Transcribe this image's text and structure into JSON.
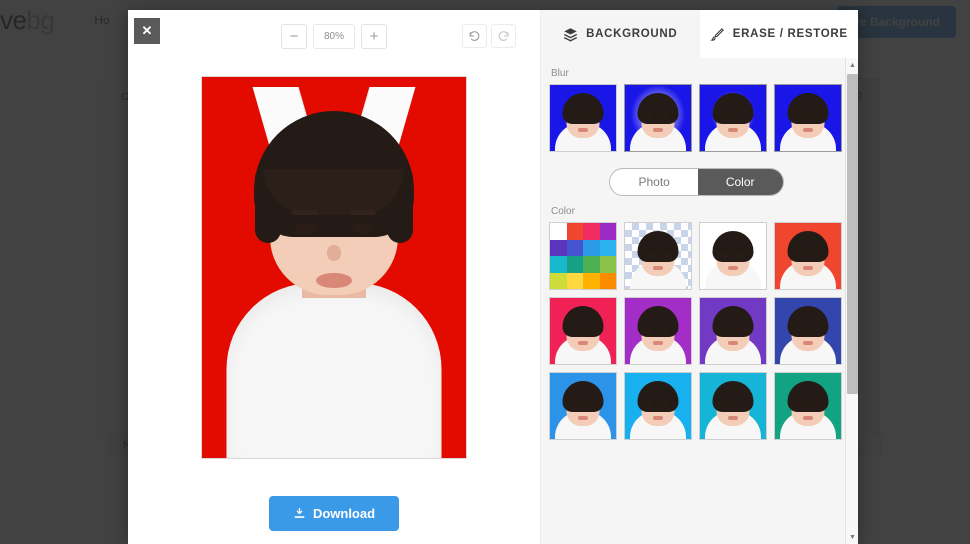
{
  "background_page": {
    "logo_main": "ove",
    "logo_accent": "bg",
    "nav": [
      {
        "label": "Ho"
      }
    ],
    "remove_background_button": "ve Background",
    "card_label": "C",
    "card_close_icon": "close-icon",
    "footer_text": "N"
  },
  "editor": {
    "toolbar": {
      "close_label": "✕",
      "zoom_out_label": "−",
      "zoom_value": "80%",
      "zoom_in_label": "+",
      "undo_icon": "undo-icon",
      "redo_icon": "redo-icon"
    },
    "canvas": {
      "background_color": "#E30B00",
      "subject": "portrait-photo"
    },
    "download_button": {
      "label": "Download",
      "icon": "download-icon",
      "color": "#3b9ae8"
    }
  },
  "panel": {
    "tabs": [
      {
        "label": "BACKGROUND",
        "icon": "layers-icon",
        "active": false
      },
      {
        "label": "ERASE / RESTORE",
        "icon": "brush-icon",
        "active": true
      }
    ],
    "blur": {
      "label": "Blur",
      "items": [
        {
          "name": "blur-0",
          "color": "#1a16e8",
          "blur": 0,
          "selected": false
        },
        {
          "name": "blur-1",
          "color": "#1a16e8",
          "blur": 2,
          "selected": true
        },
        {
          "name": "blur-2",
          "color": "#1a16e8",
          "blur": 4,
          "selected": true
        },
        {
          "name": "blur-3",
          "color": "#1a16e8",
          "blur": 7,
          "selected": true
        }
      ]
    },
    "mode_toggle": {
      "options": [
        {
          "label": "Photo",
          "active": false
        },
        {
          "label": "Color",
          "active": true
        }
      ]
    },
    "color_section": {
      "label": "Color",
      "picker": {
        "name": "color-picker-grid",
        "swatches": [
          "#ffffff",
          "#f0462f",
          "#ef2d63",
          "#9c2bc4",
          "#5b35bd",
          "#4455cf",
          "#2b9ae8",
          "#2bb3f0",
          "#18b9cc",
          "#16a085",
          "#4cb050",
          "#8bc34a",
          "#cddc39",
          "#ffd740",
          "#ffb300",
          "#fb8c00"
        ]
      },
      "items": [
        {
          "name": "transparent-background",
          "color": "transparent",
          "checker": true,
          "selected": false
        },
        {
          "name": "white-background",
          "color": "#ffffff",
          "checker": false,
          "selected": false
        },
        {
          "name": "red-background",
          "color": "#f0462f",
          "checker": false,
          "selected": false
        },
        {
          "name": "pink-background",
          "color": "#ef2155",
          "checker": false,
          "selected": false
        },
        {
          "name": "purple-background",
          "color": "#a22ec7",
          "checker": false,
          "selected": false
        },
        {
          "name": "violet-background",
          "color": "#7139c4",
          "checker": false,
          "selected": false
        },
        {
          "name": "navy-background",
          "color": "#3346ae",
          "checker": false,
          "selected": false
        },
        {
          "name": "blue-background",
          "color": "#2b93e8",
          "checker": false,
          "selected": false
        },
        {
          "name": "sky-background",
          "color": "#18b0ef",
          "checker": false,
          "selected": false
        },
        {
          "name": "cyan-background",
          "color": "#16b5d8",
          "checker": false,
          "selected": false
        },
        {
          "name": "teal-background",
          "color": "#12a383",
          "checker": false,
          "selected": false
        }
      ]
    },
    "scrollbar": {
      "up_icon": "caret-up-icon",
      "down_icon": "caret-down-icon"
    }
  }
}
